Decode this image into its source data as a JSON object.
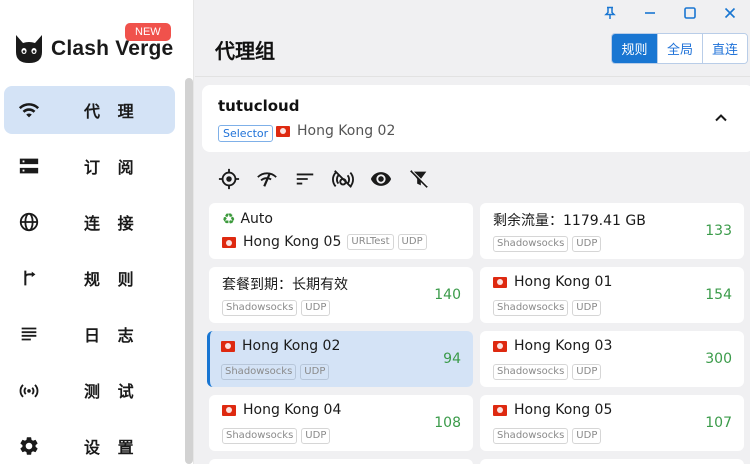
{
  "app": {
    "brand": "Clash Verge",
    "badge": "NEW"
  },
  "sidebar": {
    "items": [
      {
        "label": "代 理",
        "icon": "wifi-icon",
        "active": true
      },
      {
        "label": "订 阅",
        "icon": "storage-icon",
        "active": false
      },
      {
        "label": "连 接",
        "icon": "globe-icon",
        "active": false
      },
      {
        "label": "规 则",
        "icon": "fork-icon",
        "active": false
      },
      {
        "label": "日 志",
        "icon": "list-icon",
        "active": false
      },
      {
        "label": "测 试",
        "icon": "broadcast-icon",
        "active": false
      },
      {
        "label": "设 置",
        "icon": "gear-icon",
        "active": false
      }
    ]
  },
  "header": {
    "title": "代理组",
    "modes": [
      {
        "label": "规则",
        "active": true
      },
      {
        "label": "全局",
        "active": false
      },
      {
        "label": "直连",
        "active": false
      }
    ]
  },
  "group": {
    "name": "tutucloud",
    "type": "Selector",
    "now": "Hong Kong 02"
  },
  "toolbar": {
    "icons": [
      "locate-icon",
      "network-check-icon",
      "sort-icon",
      "wifi-off-icon",
      "eye-icon",
      "filter-off-icon"
    ]
  },
  "proxies": [
    {
      "name": "Auto",
      "sub": "Hong Kong 05",
      "tags": [
        "URLTest",
        "UDP"
      ],
      "delay": "",
      "flag": false,
      "recycle": true,
      "selected": false
    },
    {
      "name": "剩余流量：1179.41 GB",
      "tags": [
        "Shadowsocks",
        "UDP"
      ],
      "delay": "133",
      "flag": false,
      "selected": false
    },
    {
      "name": "套餐到期：长期有效",
      "tags": [
        "Shadowsocks",
        "UDP"
      ],
      "delay": "140",
      "flag": false,
      "selected": false
    },
    {
      "name": "Hong Kong 01",
      "tags": [
        "Shadowsocks",
        "UDP"
      ],
      "delay": "154",
      "flag": true,
      "selected": false
    },
    {
      "name": "Hong Kong 02",
      "tags": [
        "Shadowsocks",
        "UDP"
      ],
      "delay": "94",
      "flag": true,
      "selected": true
    },
    {
      "name": "Hong Kong 03",
      "tags": [
        "Shadowsocks",
        "UDP"
      ],
      "delay": "300",
      "flag": true,
      "selected": false
    },
    {
      "name": "Hong Kong 04",
      "tags": [
        "Shadowsocks",
        "UDP"
      ],
      "delay": "108",
      "flag": true,
      "selected": false
    },
    {
      "name": "Hong Kong 05",
      "tags": [
        "Shadowsocks",
        "UDP"
      ],
      "delay": "107",
      "flag": true,
      "selected": false
    }
  ],
  "colors": {
    "accent": "#1976d2",
    "active_bg": "#d4e3f6",
    "delay_good": "#3b9b4a",
    "badge": "#f0524c"
  }
}
